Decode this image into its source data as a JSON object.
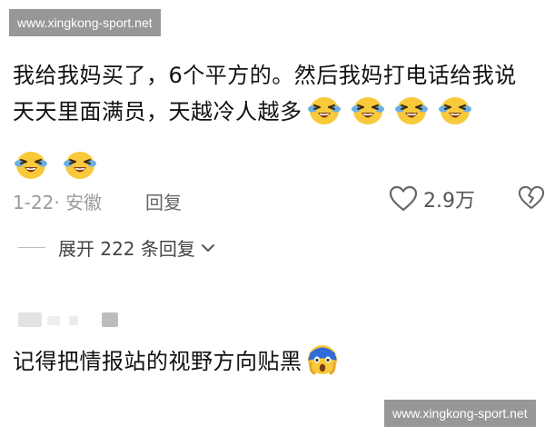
{
  "watermark": {
    "text": "www.xingkong-sport.net"
  },
  "comment1": {
    "text": "我给我妈买了，6个平方的。然后我妈打电话给我说天天里面满员，天越冷人越多",
    "meta": {
      "date_location": "1-22· 安徽",
      "reply_label": "回复",
      "like_count": "2.9万"
    },
    "expand_replies": "展开 222 条回复"
  },
  "comment2": {
    "text": "记得把情报站的视野方向贴黑"
  },
  "icons": {
    "crying_emoji": "crying-laughing-emoji",
    "scared_emoji": "screaming-fear-emoji",
    "like": "heart-outline-icon",
    "dislike": "broken-heart-icon",
    "expand": "chevron-down-icon"
  },
  "colors": {
    "meta_gray": "#9a9a9a",
    "emoji_yellow": "#f8c93a",
    "tear_blue": "#6aaee6",
    "fear_blue": "#2f6cd8"
  }
}
